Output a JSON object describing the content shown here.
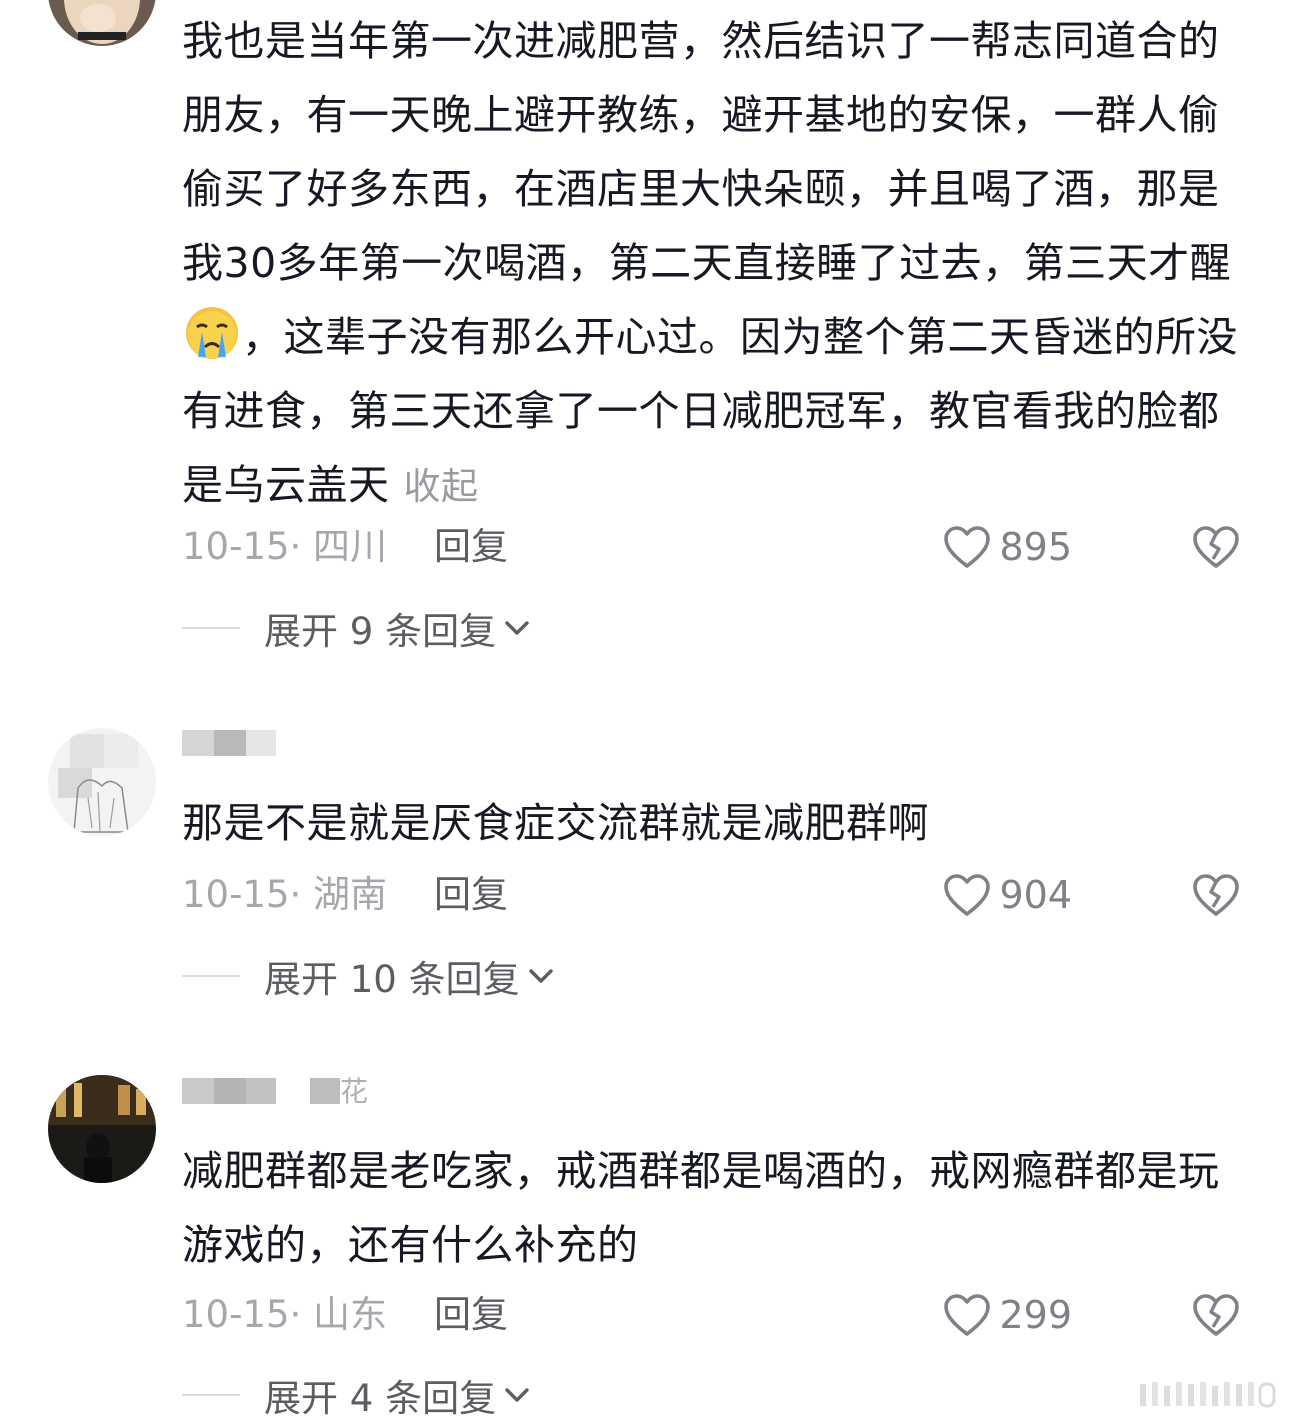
{
  "comments": [
    {
      "text_before_emoji": "我也是当年第一次进减肥营，然后结识了一帮志同道合的朋友，有一天晚上避开教练，避开基地的安保，一群人偷偷买了好多东西，在酒店里大快朵颐，并且喝了酒，那是我30多年第一次喝酒，第二天直接睡了过去，第三天才醒",
      "emoji": "crying-face",
      "text_after_emoji": "，这辈子没有那么开心过。因为整个第二天昏迷的所没有进食，第三天还拿了一个日减肥冠军，教官看我的脸都是乌云盖天",
      "collapse_label": "收起",
      "date_location": "10-15· 四川",
      "reply_label": "回复",
      "like_count": "895",
      "expand_label": "展开 9 条回复"
    },
    {
      "text": "那是不是就是厌食症交流群就是减肥群啊",
      "date_location": "10-15· 湖南",
      "reply_label": "回复",
      "like_count": "904",
      "expand_label": "展开 10 条回复"
    },
    {
      "name_fragment": "花",
      "text": "减肥群都是老吃家，戒酒群都是喝酒的，戒网瘾群都是玩游戏的，还有什么补充的",
      "date_location": "10-15· 山东",
      "reply_label": "回复",
      "like_count": "299",
      "expand_label": "展开 4 条回复"
    }
  ],
  "icons": {
    "like": "heart-outline-icon",
    "dislike": "broken-heart-icon",
    "expand": "chevron-down-icon"
  },
  "colors": {
    "text_primary": "#161823",
    "text_secondary": "#a6a7ac",
    "reply": "#5c5d63",
    "icon": "#808188"
  }
}
